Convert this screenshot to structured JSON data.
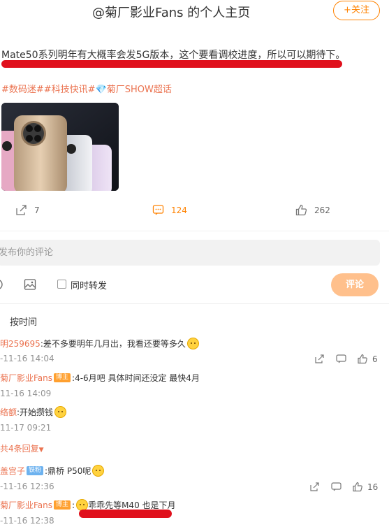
{
  "header": {
    "title": "@菊厂影业Fans 的个人主页",
    "follow_label": "+关注"
  },
  "post": {
    "text": "Mate50系列明年有大概率会发5G版本，这个要看调校进度，所以可以期待下。",
    "hashtags": "#数码迷##科技快讯#💎菊厂SHOW超话"
  },
  "actions": {
    "repost_count": "7",
    "comment_count": "124",
    "like_count": "262"
  },
  "composer": {
    "placeholder": "发布你的评论",
    "forward_label": "同时转发",
    "submit_label": "评论"
  },
  "sort_label": "按时间",
  "comments": [
    {
      "user": "明259695",
      "text": ":差不多要明年几月出，我看还要等多久",
      "time": "-11-16 14:04",
      "like_count": "6"
    },
    {
      "user": "菊厂影业Fans",
      "badge": "博主",
      "text": ":4-6月吧 具体时间还没定 最快4月",
      "time": "11-16 14:09"
    },
    {
      "user": "络额",
      "text": ":开始攒钱",
      "time": "11-17 09:21"
    },
    {
      "more": "共4条回复"
    },
    {
      "user": "盖宫子",
      "badge": "铁粉",
      "text": ":鼎桥 P50呢",
      "time": "-11-16 12:36",
      "like_count": "16"
    },
    {
      "user": "菊厂影业Fans",
      "badge": "博主",
      "text": "乖乖先等M40 也是下月",
      "time": "-11-16 12:38"
    }
  ],
  "colors": {
    "accent": "#ff8200",
    "username": "#eb7350",
    "highlight": "#e0101c"
  }
}
